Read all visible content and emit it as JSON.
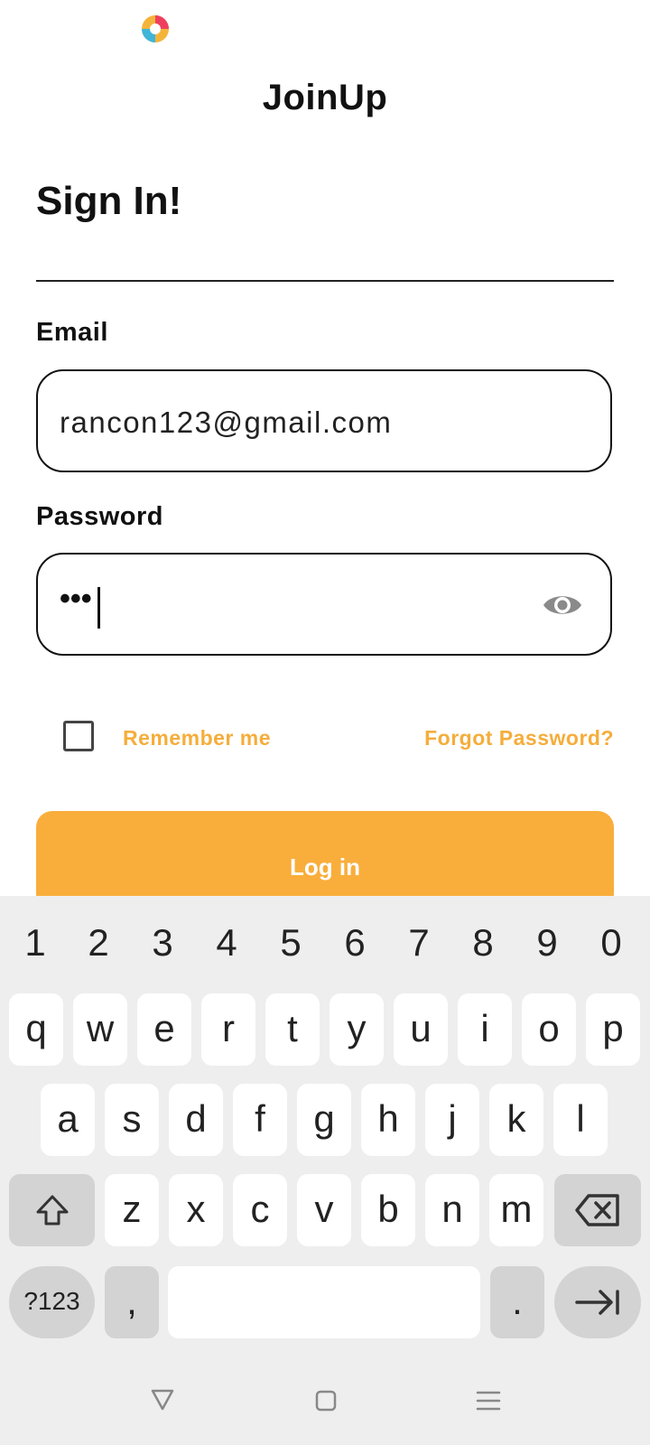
{
  "app": {
    "title": "JoinUp",
    "logo_icon": "multicolor-swirl-logo",
    "colors": {
      "accent": "#f9ae3b",
      "link": "#f5ad3b"
    }
  },
  "signin": {
    "heading": "Sign In!",
    "email_label": "Email",
    "email_value": "rancon123@gmail.com",
    "password_label": "Password",
    "password_value": "•••",
    "remember_label": "Remember me",
    "remember_checked": false,
    "forgot_label": "Forgot Password?",
    "login_label": "Log in"
  },
  "keyboard": {
    "numbers": [
      "1",
      "2",
      "3",
      "4",
      "5",
      "6",
      "7",
      "8",
      "9",
      "0"
    ],
    "row1": [
      "q",
      "w",
      "e",
      "r",
      "t",
      "y",
      "u",
      "i",
      "o",
      "p"
    ],
    "row2": [
      "a",
      "s",
      "d",
      "f",
      "g",
      "h",
      "j",
      "k",
      "l"
    ],
    "row3": [
      "z",
      "x",
      "c",
      "v",
      "b",
      "n",
      "m"
    ],
    "symbols_label": "?123",
    "comma_label": ",",
    "period_label": "."
  },
  "nav": {
    "back_icon": "triangle-back-icon",
    "home_icon": "square-home-icon",
    "menu_icon": "menu-lines-icon"
  }
}
